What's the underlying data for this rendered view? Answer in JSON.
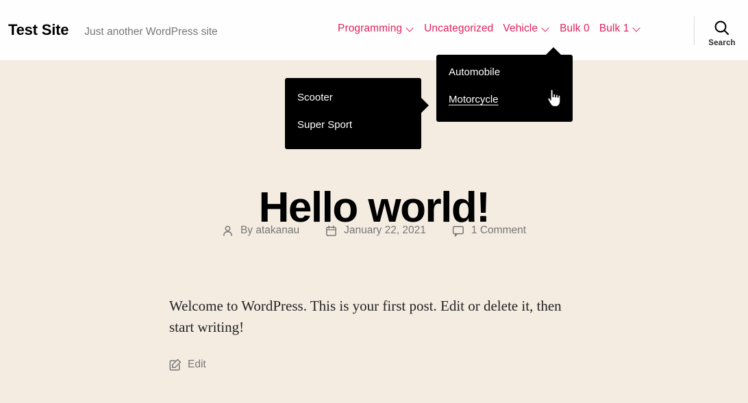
{
  "header": {
    "site_title": "Test Site",
    "tagline": "Just another WordPress site",
    "nav": [
      {
        "label": "Programming",
        "has_chevron": true
      },
      {
        "label": "Uncategorized",
        "has_chevron": false
      },
      {
        "label": "Vehicle",
        "has_chevron": true
      },
      {
        "label": "Bulk 0",
        "has_chevron": false
      },
      {
        "label": "Bulk 1",
        "has_chevron": true
      }
    ],
    "search": {
      "label": "Search",
      "icon": "search-icon"
    },
    "accent_color": "#e2215c",
    "background_color": "#fefefe"
  },
  "vehicle_dropdown": {
    "items": [
      {
        "label": "Automobile",
        "hovered": false
      },
      {
        "label": "Motorcycle",
        "hovered": true
      }
    ],
    "background_color": "#000000",
    "text_color": "#ffffff"
  },
  "motorcycle_submenu": {
    "items": [
      {
        "label": "Scooter"
      },
      {
        "label": "Super Sport"
      }
    ],
    "background_color": "#000000",
    "text_color": "#ffffff"
  },
  "cursor": {
    "type": "pointer-hand-cursor"
  },
  "post": {
    "title": "Hello world!",
    "meta": [
      {
        "icon": "person-icon",
        "text": "By atakanau"
      },
      {
        "icon": "calendar-icon",
        "text": "January 22, 2021"
      },
      {
        "icon": "comment-icon",
        "text": "1 Comment"
      }
    ],
    "body": "Welcome to WordPress. This is your first post. Edit or delete it, then start writing!",
    "edit_label": "Edit",
    "edit_icon": "pencil-edit-icon"
  },
  "page": {
    "background_color": "#f4ece1"
  }
}
